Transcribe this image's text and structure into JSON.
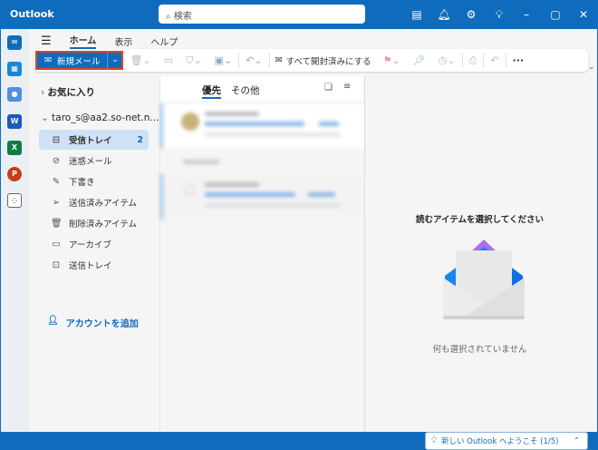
{
  "app": {
    "title": "Outlook"
  },
  "search": {
    "placeholder": "検索"
  },
  "tabs": [
    {
      "label": "ホーム"
    },
    {
      "label": "表示"
    },
    {
      "label": "ヘルプ"
    }
  ],
  "ribbon": {
    "new_mail": "新規メール",
    "mark_all_read": "すべて開封済みにする",
    "more": "···"
  },
  "folders": {
    "favorites": "お気に入り",
    "account": "taro_s@aa2.so-net.n...",
    "items": [
      {
        "label": "受信トレイ",
        "count": "2",
        "icon": "inbox-icon"
      },
      {
        "label": "迷惑メール",
        "icon": "junk-icon"
      },
      {
        "label": "下書き",
        "icon": "draft-icon"
      },
      {
        "label": "送信済みアイテム",
        "icon": "sent-icon"
      },
      {
        "label": "削除済みアイテム",
        "icon": "trash-icon"
      },
      {
        "label": "アーカイブ",
        "icon": "archive-icon"
      },
      {
        "label": "送信トレイ",
        "icon": "outbox-icon"
      }
    ],
    "add_account": "アカウントを追加"
  },
  "list": {
    "tabs": [
      {
        "label": "優先"
      },
      {
        "label": "その他"
      }
    ]
  },
  "reading": {
    "title": "読むアイテムを選択してください",
    "empty": "何も選択されていません",
    "welcome": "新しい Outlook へようこそ (1/5)"
  },
  "colors": {
    "brand": "#0f6cbd",
    "highlight": "#e3411f"
  }
}
